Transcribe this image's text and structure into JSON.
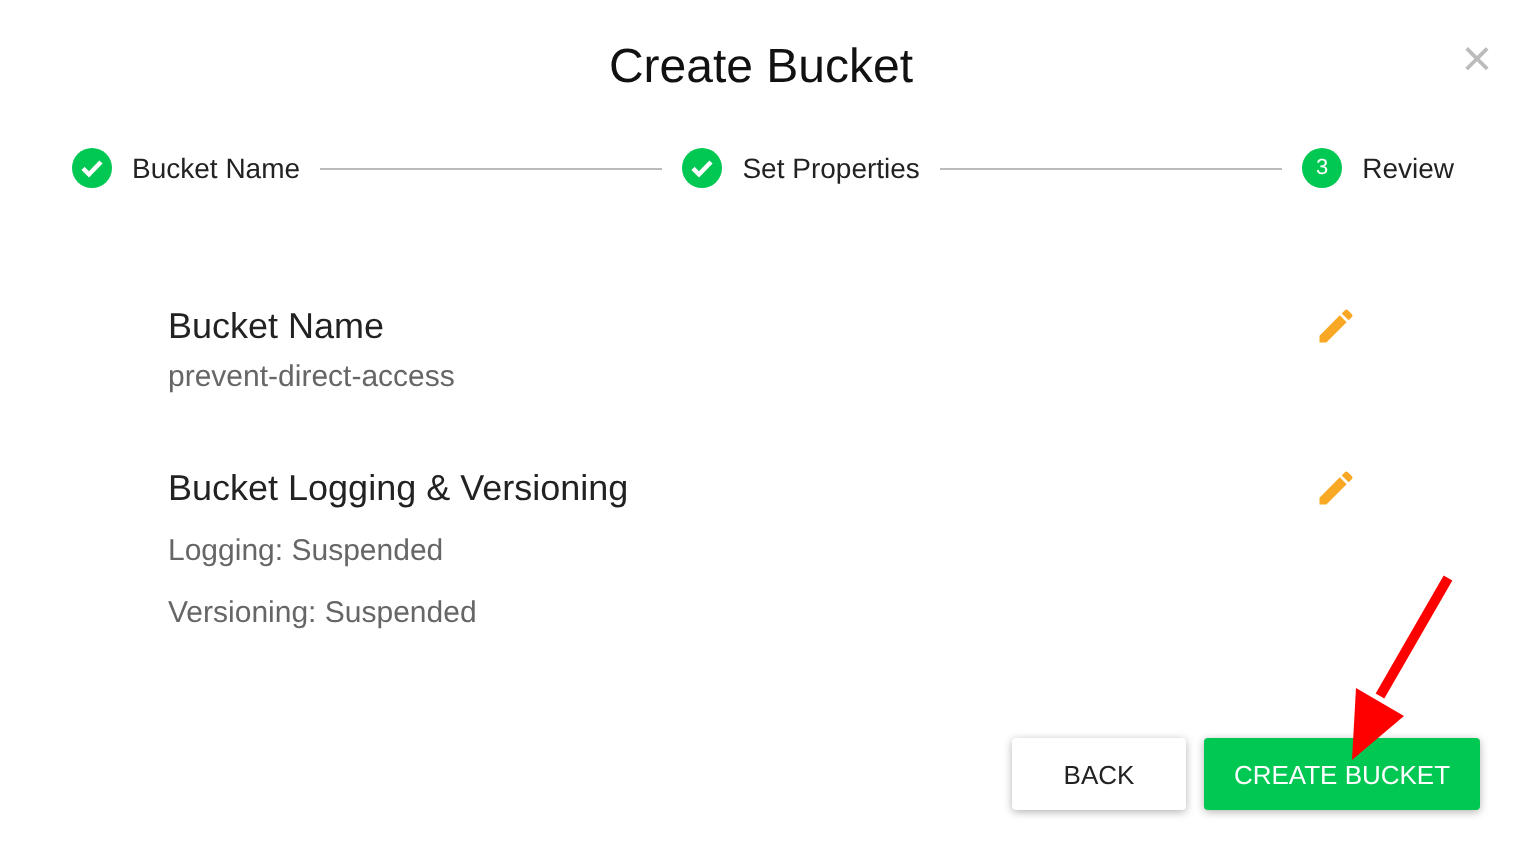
{
  "dialog": {
    "title": "Create Bucket",
    "close": "×"
  },
  "steps": [
    {
      "label": "Bucket Name",
      "completed": true
    },
    {
      "label": "Set Properties",
      "completed": true
    },
    {
      "label": "Review",
      "completed": false,
      "number": "3"
    }
  ],
  "sections": [
    {
      "title": "Bucket Name",
      "lines": [
        "prevent-direct-access"
      ]
    },
    {
      "title": "Bucket Logging & Versioning",
      "lines": [
        "Logging: Suspended",
        "Versioning: Suspended"
      ]
    }
  ],
  "buttons": [
    {
      "label": "BACK",
      "kind": "secondary"
    },
    {
      "label": "CREATE BUCKET",
      "kind": "primary"
    }
  ],
  "annotation": {
    "kind": "arrow"
  }
}
